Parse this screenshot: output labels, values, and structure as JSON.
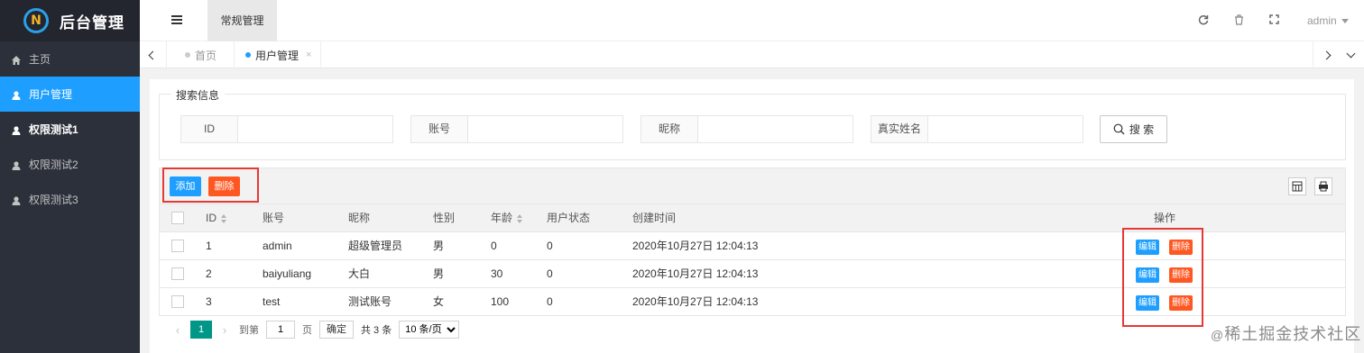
{
  "app": {
    "title": "后台管理",
    "logo_letter": "N"
  },
  "sidebar": {
    "items": [
      {
        "label": "主页",
        "icon": "home-icon"
      },
      {
        "label": "用户管理",
        "icon": "user-icon"
      },
      {
        "label": "权限测试1",
        "icon": "user-icon"
      },
      {
        "label": "权限测试2",
        "icon": "user-icon"
      },
      {
        "label": "权限测试3",
        "icon": "user-icon"
      }
    ],
    "active_index": 1
  },
  "header": {
    "nav_tab": "常规管理",
    "user": "admin"
  },
  "tabs": [
    {
      "label": "首页",
      "active": false
    },
    {
      "label": "用户管理",
      "active": true,
      "close": "×"
    }
  ],
  "search": {
    "legend": "搜索信息",
    "fields": [
      {
        "label": "ID",
        "value": ""
      },
      {
        "label": "账号",
        "value": ""
      },
      {
        "label": "昵称",
        "value": ""
      },
      {
        "label": "真实姓名",
        "value": ""
      }
    ],
    "button": "搜 索"
  },
  "toolbar": {
    "add": "添加",
    "delete": "删除"
  },
  "table": {
    "columns": [
      "ID",
      "账号",
      "昵称",
      "性别",
      "年龄",
      "用户状态",
      "创建时间",
      "操作"
    ],
    "rows": [
      {
        "id": "1",
        "account": "admin",
        "nickname": "超级管理员",
        "gender": "男",
        "age": "0",
        "status": "0",
        "created": "2020年10月27日 12:04:13"
      },
      {
        "id": "2",
        "account": "baiyuliang",
        "nickname": "大白",
        "gender": "男",
        "age": "30",
        "status": "0",
        "created": "2020年10月27日 12:04:13"
      },
      {
        "id": "3",
        "account": "test",
        "nickname": "测试账号",
        "gender": "女",
        "age": "100",
        "status": "0",
        "created": "2020年10月27日 12:04:13"
      }
    ],
    "row_actions": {
      "edit": "编辑",
      "delete": "删除"
    }
  },
  "pagination": {
    "current": "1",
    "goto_prefix": "到第",
    "goto_value": "1",
    "goto_suffix": "页",
    "confirm": "确定",
    "total": "共 3 条",
    "page_size": "10 条/页"
  },
  "watermark": {
    "prefix": "@",
    "text": "稀土掘金技术社区"
  },
  "colors": {
    "blue": "#1E9FFF",
    "red": "#FF5722",
    "sidebar": "#2b303b",
    "pager_active": "#009688",
    "highlight": "#e53935"
  }
}
